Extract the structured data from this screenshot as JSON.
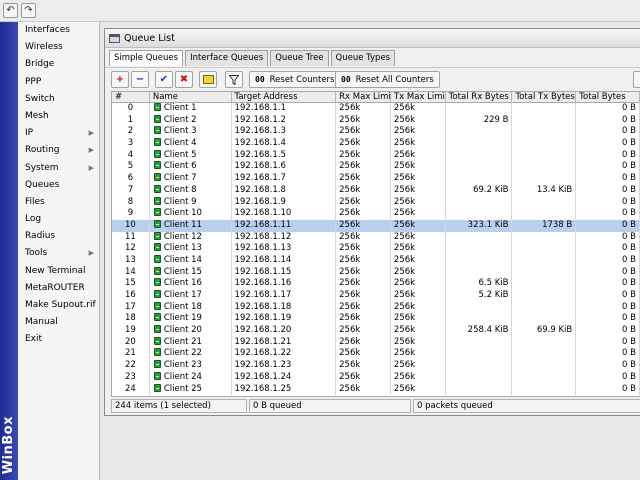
{
  "app": {
    "brand": "WinBox"
  },
  "toolbar": {
    "undo_icon": "↶",
    "redo_icon": "↷"
  },
  "menu": [
    {
      "label": "Interfaces",
      "arrow": false
    },
    {
      "label": "Wireless",
      "arrow": false
    },
    {
      "label": "Bridge",
      "arrow": false
    },
    {
      "label": "PPP",
      "arrow": false
    },
    {
      "label": "Switch",
      "arrow": false
    },
    {
      "label": "Mesh",
      "arrow": false
    },
    {
      "label": "IP",
      "arrow": true
    },
    {
      "label": "Routing",
      "arrow": true
    },
    {
      "label": "System",
      "arrow": true
    },
    {
      "label": "Queues",
      "arrow": false
    },
    {
      "label": "Files",
      "arrow": false
    },
    {
      "label": "Log",
      "arrow": false
    },
    {
      "label": "Radius",
      "arrow": false
    },
    {
      "label": "Tools",
      "arrow": true
    },
    {
      "label": "New Terminal",
      "arrow": false
    },
    {
      "label": "MetaROUTER",
      "arrow": false
    },
    {
      "label": "Make Supout.rif",
      "arrow": false
    },
    {
      "label": "Manual",
      "arrow": false
    },
    {
      "label": "Exit",
      "arrow": false
    }
  ],
  "window": {
    "title": "Queue List",
    "tabs": [
      "Simple Queues",
      "Interface Queues",
      "Queue Tree",
      "Queue Types"
    ],
    "active_tab": 0,
    "buttons": {
      "add": "+",
      "remove": "−",
      "enable": "✔",
      "disable": "✖",
      "comment": "",
      "filter": "",
      "reset_counters": "Reset Counters",
      "reset_all_counters": "Reset All Counters",
      "oo": "00"
    },
    "columns": [
      "#",
      "Name",
      "Target Address",
      "Rx Max Limit",
      "Tx Max Limit",
      "Total Rx Bytes",
      "Total Tx Bytes",
      "Total Bytes"
    ],
    "rows": [
      {
        "id": "0",
        "name": "Client 1",
        "target": "192.168.1.1",
        "rx_limit": "256k",
        "tx_limit": "256k",
        "rx_bytes": "",
        "tx_bytes": "",
        "total": "0 B"
      },
      {
        "id": "1",
        "name": "Client 2",
        "target": "192.168.1.2",
        "rx_limit": "256k",
        "tx_limit": "256k",
        "rx_bytes": "229 B",
        "tx_bytes": "",
        "total": "0 B"
      },
      {
        "id": "2",
        "name": "Client 3",
        "target": "192.168.1.3",
        "rx_limit": "256k",
        "tx_limit": "256k",
        "rx_bytes": "",
        "tx_bytes": "",
        "total": "0 B"
      },
      {
        "id": "3",
        "name": "Client 4",
        "target": "192.168.1.4",
        "rx_limit": "256k",
        "tx_limit": "256k",
        "rx_bytes": "",
        "tx_bytes": "",
        "total": "0 B"
      },
      {
        "id": "4",
        "name": "Client 5",
        "target": "192.168.1.5",
        "rx_limit": "256k",
        "tx_limit": "256k",
        "rx_bytes": "",
        "tx_bytes": "",
        "total": "0 B"
      },
      {
        "id": "5",
        "name": "Client 6",
        "target": "192.168.1.6",
        "rx_limit": "256k",
        "tx_limit": "256k",
        "rx_bytes": "",
        "tx_bytes": "",
        "total": "0 B"
      },
      {
        "id": "6",
        "name": "Client 7",
        "target": "192.168.1.7",
        "rx_limit": "256k",
        "tx_limit": "256k",
        "rx_bytes": "",
        "tx_bytes": "",
        "total": "0 B"
      },
      {
        "id": "7",
        "name": "Client 8",
        "target": "192.168.1.8",
        "rx_limit": "256k",
        "tx_limit": "256k",
        "rx_bytes": "69.2 KiB",
        "tx_bytes": "13.4 KiB",
        "total": "0 B"
      },
      {
        "id": "8",
        "name": "Client 9",
        "target": "192.168.1.9",
        "rx_limit": "256k",
        "tx_limit": "256k",
        "rx_bytes": "",
        "tx_bytes": "",
        "total": "0 B"
      },
      {
        "id": "9",
        "name": "Client 10",
        "target": "192.168.1.10",
        "rx_limit": "256k",
        "tx_limit": "256k",
        "rx_bytes": "",
        "tx_bytes": "",
        "total": "0 B"
      },
      {
        "id": "10",
        "name": "Client 11",
        "target": "192.168.1.11",
        "rx_limit": "256k",
        "tx_limit": "256k",
        "rx_bytes": "323.1 KiB",
        "tx_bytes": "1738 B",
        "total": "0 B",
        "selected": true
      },
      {
        "id": "11",
        "name": "Client 12",
        "target": "192.168.1.12",
        "rx_limit": "256k",
        "tx_limit": "256k",
        "rx_bytes": "",
        "tx_bytes": "",
        "total": "0 B"
      },
      {
        "id": "12",
        "name": "Client 13",
        "target": "192.168.1.13",
        "rx_limit": "256k",
        "tx_limit": "256k",
        "rx_bytes": "",
        "tx_bytes": "",
        "total": "0 B"
      },
      {
        "id": "13",
        "name": "Client 14",
        "target": "192.168.1.14",
        "rx_limit": "256k",
        "tx_limit": "256k",
        "rx_bytes": "",
        "tx_bytes": "",
        "total": "0 B"
      },
      {
        "id": "14",
        "name": "Client 15",
        "target": "192.168.1.15",
        "rx_limit": "256k",
        "tx_limit": "256k",
        "rx_bytes": "",
        "tx_bytes": "",
        "total": "0 B"
      },
      {
        "id": "15",
        "name": "Client 16",
        "target": "192.168.1.16",
        "rx_limit": "256k",
        "tx_limit": "256k",
        "rx_bytes": "6.5 KiB",
        "tx_bytes": "",
        "total": "0 B"
      },
      {
        "id": "16",
        "name": "Client 17",
        "target": "192.168.1.17",
        "rx_limit": "256k",
        "tx_limit": "256k",
        "rx_bytes": "5.2 KiB",
        "tx_bytes": "",
        "total": "0 B"
      },
      {
        "id": "17",
        "name": "Client 18",
        "target": "192.168.1.18",
        "rx_limit": "256k",
        "tx_limit": "256k",
        "rx_bytes": "",
        "tx_bytes": "",
        "total": "0 B"
      },
      {
        "id": "18",
        "name": "Client 19",
        "target": "192.168.1.19",
        "rx_limit": "256k",
        "tx_limit": "256k",
        "rx_bytes": "",
        "tx_bytes": "",
        "total": "0 B"
      },
      {
        "id": "19",
        "name": "Client 20",
        "target": "192.168.1.20",
        "rx_limit": "256k",
        "tx_limit": "256k",
        "rx_bytes": "258.4 KiB",
        "tx_bytes": "69.9 KiB",
        "total": "0 B"
      },
      {
        "id": "20",
        "name": "Client 21",
        "target": "192.168.1.21",
        "rx_limit": "256k",
        "tx_limit": "256k",
        "rx_bytes": "",
        "tx_bytes": "",
        "total": "0 B"
      },
      {
        "id": "21",
        "name": "Client 22",
        "target": "192.168.1.22",
        "rx_limit": "256k",
        "tx_limit": "256k",
        "rx_bytes": "",
        "tx_bytes": "",
        "total": "0 B"
      },
      {
        "id": "22",
        "name": "Client 23",
        "target": "192.168.1.23",
        "rx_limit": "256k",
        "tx_limit": "256k",
        "rx_bytes": "",
        "tx_bytes": "",
        "total": "0 B"
      },
      {
        "id": "23",
        "name": "Client 24",
        "target": "192.168.1.24",
        "rx_limit": "256k",
        "tx_limit": "256k",
        "rx_bytes": "",
        "tx_bytes": "",
        "total": "0 B"
      },
      {
        "id": "24",
        "name": "Client 25",
        "target": "192.168.1.25",
        "rx_limit": "256k",
        "tx_limit": "256k",
        "rx_bytes": "",
        "tx_bytes": "",
        "total": "0 B"
      }
    ],
    "status": {
      "items": "244 items (1 selected)",
      "queued": "0 B queued",
      "packets": "0 packets queued"
    }
  },
  "colors": {
    "band": "#2a3aa8",
    "selected_row": "#b9cff0",
    "queue_icon": "#2a9a3a"
  }
}
